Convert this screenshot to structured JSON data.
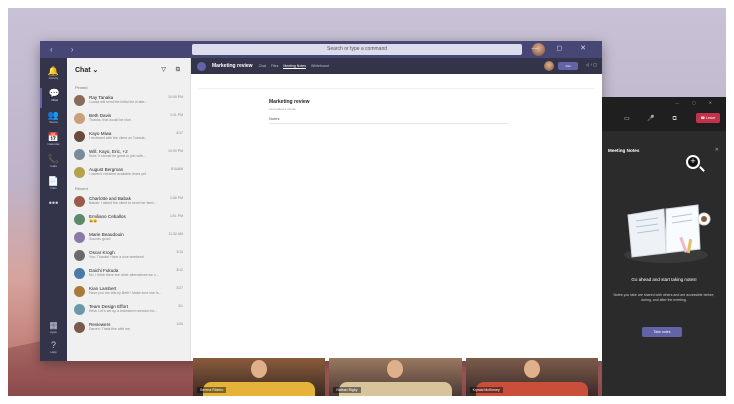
{
  "app": {
    "search_placeholder": "Search or type a command",
    "nav_arrows": "‹ ›",
    "compose": "✎",
    "window_controls": [
      "—",
      "◻",
      "✕"
    ]
  },
  "rail": [
    {
      "icon": "bell-icon",
      "glyph": "🔔",
      "label": "Activity"
    },
    {
      "icon": "chat-icon",
      "glyph": "💬",
      "label": "Chat"
    },
    {
      "icon": "teams-icon",
      "glyph": "👥",
      "label": "Teams"
    },
    {
      "icon": "calendar-icon",
      "glyph": "📅",
      "label": "Calendar"
    },
    {
      "icon": "calls-icon",
      "glyph": "📞",
      "label": "Calls"
    },
    {
      "icon": "files-icon",
      "glyph": "📄",
      "label": "Files"
    },
    {
      "icon": "more-icon",
      "glyph": "•••",
      "label": ""
    },
    {
      "icon": "apps-icon",
      "glyph": "▦",
      "label": "Apps"
    },
    {
      "icon": "help-icon",
      "glyph": "?",
      "label": "Help"
    }
  ],
  "chat": {
    "title": "Chat ⌄",
    "filter_icon": "▽",
    "video_icon": "⧉",
    "pinned_label": "Pinned",
    "recent_label": "Recent",
    "pinned": [
      {
        "name": "Ray Tanaka",
        "preview": "Louisa will send the initial list of atte...",
        "time": "10:00 PM",
        "color": "#8a6a5a"
      },
      {
        "name": "Beth Davis",
        "preview": "Thanks, that would be nice.",
        "time": "1:41 PM",
        "color": "#c9a07a"
      },
      {
        "name": "Kayo Miwa",
        "preview": "I reviewed with the client on Tuesda...",
        "time": "4/17",
        "color": "#6a4a3a"
      },
      {
        "name": "Will, Kayo, Eric, +2",
        "preview": "Sure, it should be great to join with...",
        "time": "10:00 PM",
        "color": "#7a8a9a"
      },
      {
        "name": "August Bergman",
        "preview": "I haven't checked available times yet",
        "time": "8:04AM",
        "color": "#b5a24a"
      }
    ],
    "recent": [
      {
        "name": "Charlotte and Babak",
        "preview": "Babak: I asked the client to send her feed...",
        "time": "1:56 PM",
        "color": "#9a5a4a"
      },
      {
        "name": "Emiliano Ceballos",
        "preview": "😀😀",
        "time": "1:51 PM",
        "color": "#5a8a6a"
      },
      {
        "name": "Marie Beaudouin",
        "preview": "Sounds good!",
        "time": "11:32 AM",
        "color": "#8a7aaa"
      },
      {
        "name": "Oscar Krogh",
        "preview": "You: Thanks! Have a nice weekend",
        "time": "3/13",
        "color": "#6a6a6a"
      },
      {
        "name": "Daichi Fukuda",
        "preview": "No, I think there are other alternatives we c...",
        "time": "3/12",
        "color": "#4a7aaa"
      },
      {
        "name": "Kian Lambert",
        "preview": "Have you ran this by Beth? Make sure she is...",
        "time": "3/27",
        "color": "#aa7a3a"
      },
      {
        "name": "Team Design Effort",
        "preview": "Reta: Let's set up a brainstorm session for...",
        "time": "3/1",
        "color": "#6a9aaa"
      },
      {
        "name": "Reviewers",
        "preview": "Darren: Thats fine with me",
        "time": "1/26",
        "color": "#7a5a4a"
      }
    ]
  },
  "meeting": {
    "title": "Marketing review",
    "tabs": [
      "Chat",
      "Files",
      "Meeting Notes",
      "Whiteboard"
    ],
    "active_tab": "Meeting Notes",
    "join_label": "Join",
    "more_label": "◁ ↑ ▢",
    "doc_title": "Marketing review",
    "doc_subtitle": "Last edited a minute",
    "notes_label": "Notes",
    "participants": [
      {
        "name": "Serena Ribeiro"
      },
      {
        "name": "Nathan Rigby"
      },
      {
        "name": "Krystal McKinney"
      }
    ]
  },
  "notes_panel": {
    "window_controls": [
      "—",
      "◻",
      "✕"
    ],
    "call_icons": [
      "▭",
      "🎤",
      "⧉"
    ],
    "leave_label": "☎ Leave",
    "title": "Meeting Notes",
    "close": "✕",
    "headline": "Go ahead and start taking notes!",
    "body": "Notes you take are shared with others and are accessible before, during, and after the meeting.",
    "cta": "Take notes",
    "cursor": "+"
  },
  "colors": {
    "teams_purple": "#6264a7",
    "titlebar": "#464775",
    "leave_red": "#c4314b"
  }
}
